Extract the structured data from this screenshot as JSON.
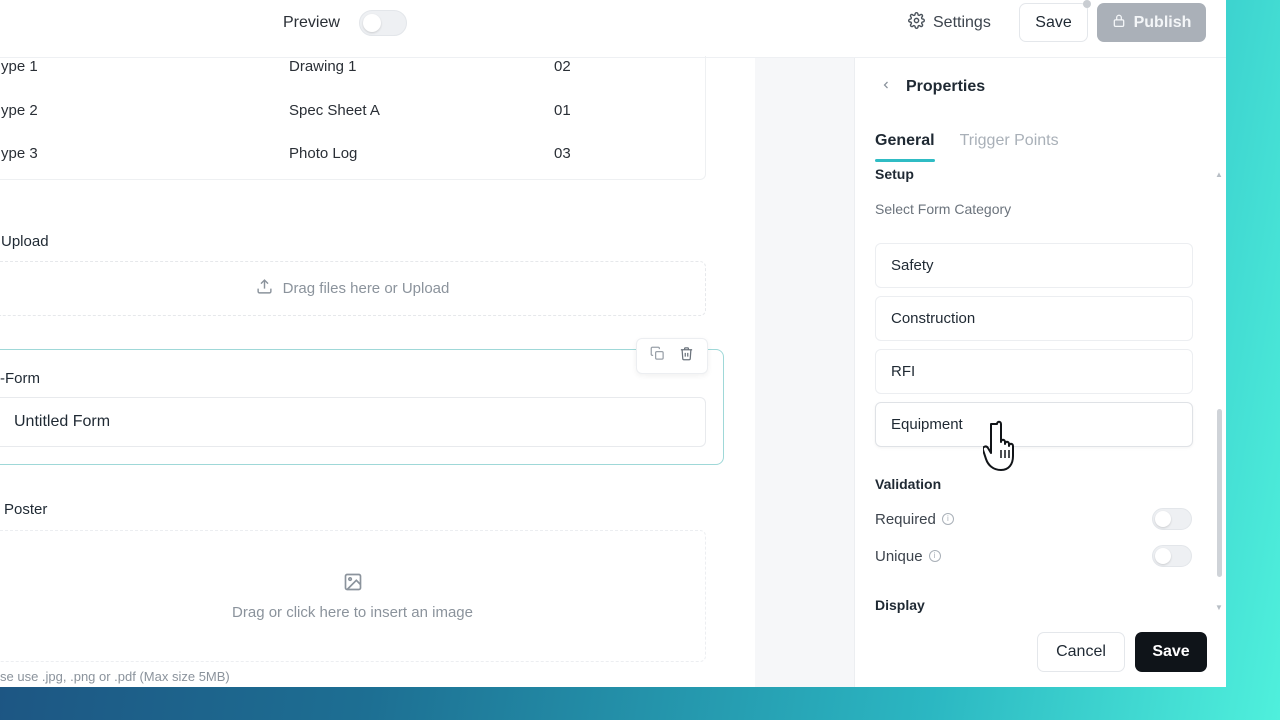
{
  "topbar": {
    "preview_label": "Preview",
    "settings_label": "Settings",
    "save_label": "Save",
    "publish_label": "Publish"
  },
  "canvas": {
    "table_rows": [
      {
        "type": "ype 1",
        "document": "Drawing 1",
        "number": "02"
      },
      {
        "type": "ype 2",
        "document": "Spec Sheet A",
        "number": "01"
      },
      {
        "type": "ype 3",
        "document": "Photo Log",
        "number": "03"
      }
    ],
    "upload": {
      "label": "Upload",
      "drop_text": "Drag files here or Upload"
    },
    "subform": {
      "label": "-Form",
      "value": "Untitled Form"
    },
    "poster": {
      "label": "Poster",
      "drop_text": "Drag or click here to insert an image",
      "hint": "se use .jpg, .png or .pdf (Max size 5MB)"
    }
  },
  "properties": {
    "title": "Properties",
    "tabs": [
      {
        "label": "General",
        "active": true
      },
      {
        "label": "Trigger Points",
        "active": false
      }
    ],
    "setup_title": "Setup",
    "category_label": "Select Form Category",
    "categories": [
      "Safety",
      "Construction",
      "RFI",
      "Equipment"
    ],
    "validation_title": "Validation",
    "validation": [
      {
        "label": "Required",
        "enabled": false
      },
      {
        "label": "Unique",
        "enabled": false
      }
    ],
    "display_title": "Display",
    "cancel_label": "Cancel",
    "save_label": "Save"
  },
  "colors": {
    "accent": "#2fbcc4",
    "publish_disabled": "#aab0b8",
    "primary_button": "#0f1419"
  }
}
